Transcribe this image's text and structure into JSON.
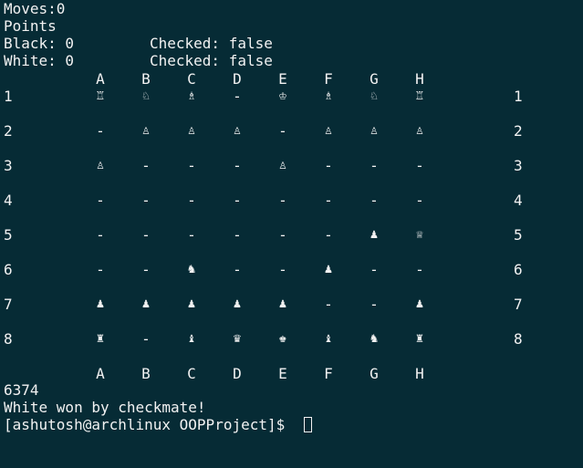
{
  "header": {
    "moves_line": "Moves:0",
    "points_line": "Points",
    "black_points": "Black: 0",
    "white_points": "White: 0",
    "black_checked": "Checked: false",
    "white_checked": "Checked: false"
  },
  "board": {
    "columns": [
      "A",
      "B",
      "C",
      "D",
      "E",
      "F",
      "G",
      "H"
    ],
    "rows": [
      "1",
      "2",
      "3",
      "4",
      "5",
      "6",
      "7",
      "8"
    ],
    "cells": [
      [
        "♖",
        "♘",
        "♗",
        "-",
        "♔",
        "♗",
        "♘",
        "♖"
      ],
      [
        "-",
        "♙",
        "♙",
        "♙",
        "-",
        "♙",
        "♙",
        "♙"
      ],
      [
        "♙",
        "-",
        "-",
        "-",
        "♙",
        "-",
        "-",
        "-"
      ],
      [
        "-",
        "-",
        "-",
        "-",
        "-",
        "-",
        "-",
        "-"
      ],
      [
        "-",
        "-",
        "-",
        "-",
        "-",
        "-",
        "♟",
        "♕"
      ],
      [
        "-",
        "-",
        "♞",
        "-",
        "-",
        "♟",
        "-",
        "-"
      ],
      [
        "♟",
        "♟",
        "♟",
        "♟",
        "♟",
        "-",
        "-",
        "♟"
      ],
      [
        "♜",
        "-",
        "♝",
        "♛",
        "♚",
        "♝",
        "♞",
        "♜"
      ]
    ]
  },
  "footer": {
    "input_echo": "6374",
    "result": "White won by checkmate!",
    "prompt": "[ashutosh@archlinux OOPProject]$ "
  }
}
